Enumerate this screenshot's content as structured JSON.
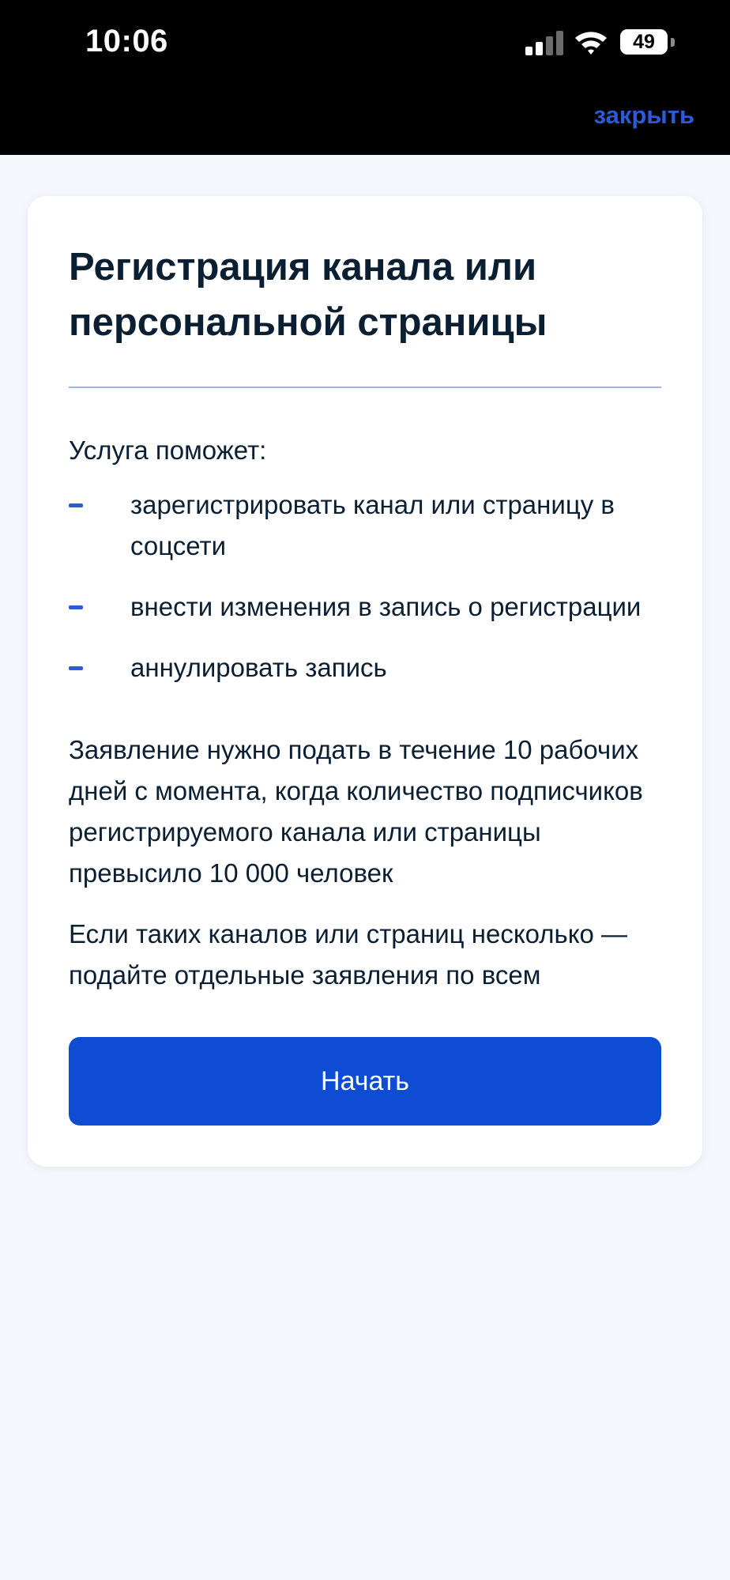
{
  "status_bar": {
    "time": "10:06",
    "battery": "49",
    "icons": [
      "signal-icon",
      "wifi-icon",
      "battery-icon"
    ]
  },
  "header": {
    "close_label": "закрыть"
  },
  "card": {
    "title": "Регистрация канала или персональной страницы",
    "intro": "Услуга поможет:",
    "bullets": [
      "зарегистрировать канал или страницу в соцсети",
      "внести изменения в запись о регистрации",
      "аннулировать запись"
    ],
    "paragraph_1": "Заявление нужно подать в течение 10 рабочих дней с момента, когда количество подписчиков регистрируемого канала или страницы превысило 10 000 человек",
    "paragraph_2": "Если таких каналов или страниц несколько — подайте отдельные заявления по всем",
    "start_button": "Начать"
  },
  "colors": {
    "accent": "#0d4cd3",
    "link": "#2d5bd8",
    "text": "#0b1f33",
    "page_background": "#f5f7fd"
  }
}
